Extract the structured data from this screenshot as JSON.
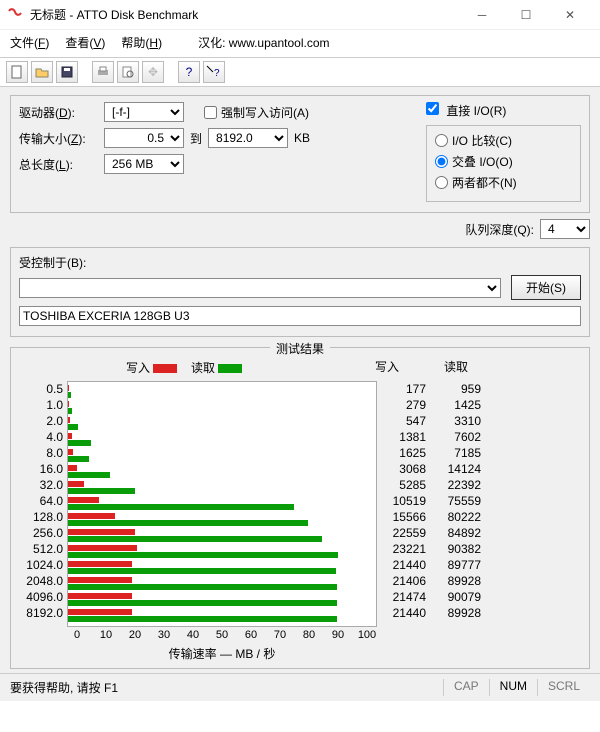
{
  "window": {
    "title": "无标题 - ATTO Disk Benchmark"
  },
  "menubar": {
    "file": "文件",
    "file_key": "F",
    "view": "查看",
    "view_key": "V",
    "help": "帮助",
    "help_key": "H",
    "extra_label": "汉化:",
    "url": "www.upantool.com"
  },
  "params": {
    "drive_label_pre": "驱动器(",
    "drive_key": "D",
    "drive_label_suf": "):",
    "drive_value": "[-f-]",
    "force_label_pre": "强制写入访问(",
    "force_key": "A",
    "force_label_suf": ")",
    "xfer_label_pre": "传输大小(",
    "xfer_key": "Z",
    "xfer_label_suf": "):",
    "xfer_from": "0.5",
    "to_label": "到",
    "xfer_to": "8192.0",
    "xfer_unit": "KB",
    "len_label_pre": "总长度(",
    "len_key": "L",
    "len_label_suf": "):",
    "length_value": "256 MB",
    "direct_label_pre": "直接 I/O(",
    "direct_key": "R",
    "direct_label_suf": ")",
    "io_compare_pre": "I/O 比较(",
    "io_compare_key": "C",
    "io_compare_suf": ")",
    "overlap_pre": "交叠 I/O(",
    "overlap_key": "O",
    "overlap_suf": ")",
    "neither_pre": "两者都不(",
    "neither_key": "N",
    "neither_suf": ")",
    "depth_label_pre": "队列深度(",
    "depth_key": "Q",
    "depth_label_suf": "):",
    "depth_value": "4"
  },
  "controlled": {
    "label_pre": "受控制于(",
    "key": "B",
    "label_suf": "):",
    "value": "",
    "start_label_pre": "开始(",
    "start_key": "S",
    "start_label_suf": ")",
    "device_text": "TOSHIBA EXCERIA 128GB U3"
  },
  "results": {
    "title": "测试结果",
    "write_label": "写入",
    "read_label": "读取",
    "axis_label": "传输速率 — MB / 秒"
  },
  "chart_data": {
    "type": "bar",
    "orientation": "horizontal",
    "categories": [
      "0.5",
      "1.0",
      "2.0",
      "4.0",
      "8.0",
      "16.0",
      "32.0",
      "64.0",
      "128.0",
      "256.0",
      "512.0",
      "1024.0",
      "2048.0",
      "4096.0",
      "8192.0"
    ],
    "series": [
      {
        "name": "写入",
        "color": "#d22",
        "values_kb_s": [
          177,
          279,
          547,
          1381,
          1625,
          3068,
          5285,
          10519,
          15566,
          22559,
          23221,
          21440,
          21406,
          21474,
          21440
        ]
      },
      {
        "name": "读取",
        "color": "#0a9d0a",
        "values_kb_s": [
          959,
          1425,
          3310,
          7602,
          7185,
          14124,
          22392,
          75559,
          80222,
          84892,
          90382,
          89777,
          89928,
          90079,
          89928
        ]
      }
    ],
    "xlabel": "传输速率 — MB / 秒",
    "ylabel": "",
    "xlim_mb_s": [
      0,
      100
    ],
    "x_ticks": [
      0,
      10,
      20,
      30,
      40,
      50,
      60,
      70,
      80,
      90,
      100
    ]
  },
  "status": {
    "help_text": "要获得帮助, 请按 F1",
    "cap": "CAP",
    "num": "NUM",
    "scrl": "SCRL"
  }
}
